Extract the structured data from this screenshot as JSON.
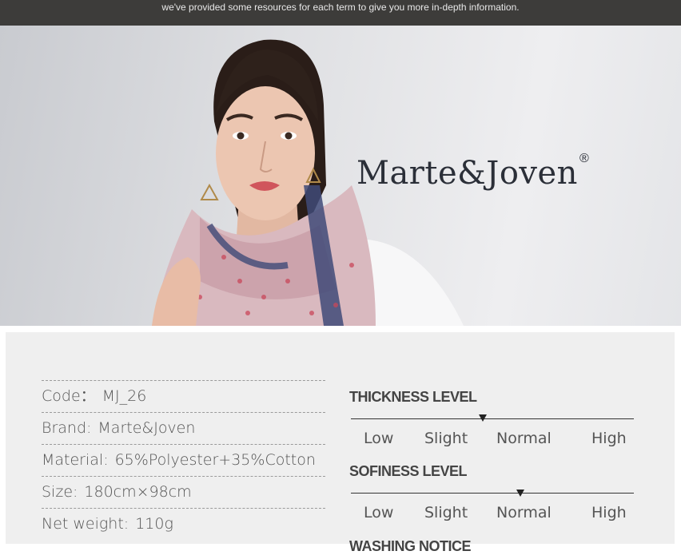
{
  "top_banner": {
    "text": "we've provided some resources for each term to give you more in-depth information."
  },
  "hero": {
    "brand": "Marte&Joven",
    "registered_mark": "®"
  },
  "specs": [
    {
      "label": "Code：",
      "value": "MJ_26"
    },
    {
      "label": "Brand:",
      "value": "Marte&Joven"
    },
    {
      "label": "Material:",
      "value": "65%Polyester+35%Cotton"
    },
    {
      "label": "Size:",
      "value": "180cm×98cm"
    },
    {
      "label": "Net weight:",
      "value": "110g"
    }
  ],
  "thickness": {
    "title": "THICKNESS LEVEL",
    "options": [
      "Low",
      "Slight",
      "Normal",
      "High"
    ],
    "selected": "Normal"
  },
  "softness": {
    "title": "SOFINESS LEVEL",
    "options": [
      "Low",
      "Slight",
      "Normal",
      "High"
    ],
    "selected": "Normal"
  },
  "washing": {
    "title": "WASHING NOTICE"
  }
}
